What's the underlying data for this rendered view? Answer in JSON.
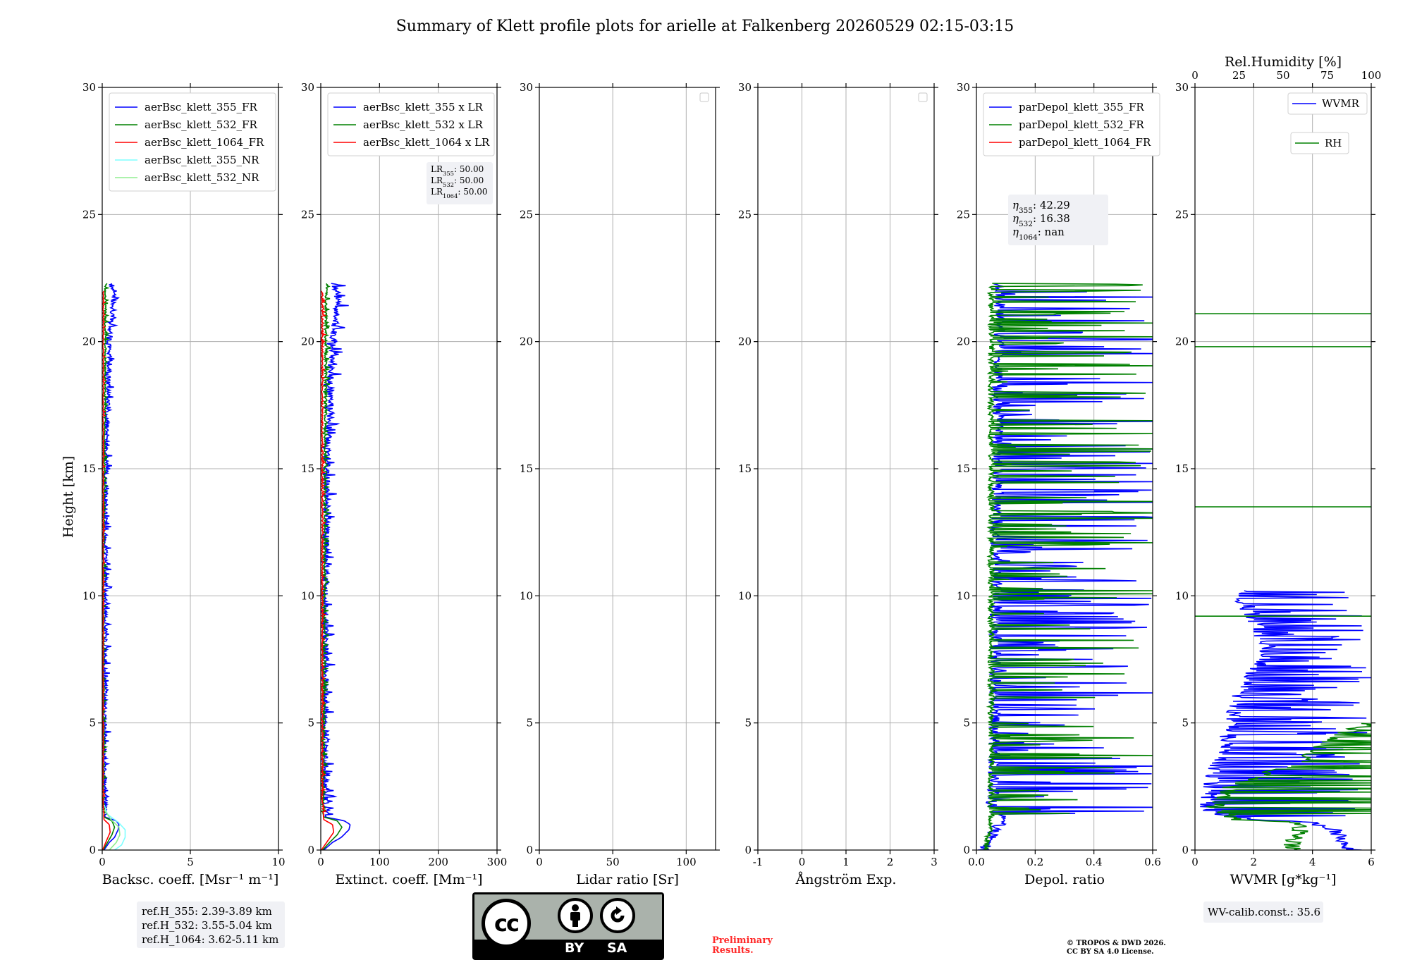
{
  "title": "Summary of Klett profile plots for arielle at Falkenberg 20260529 02:15-03:15",
  "ylabel": "Height [km]",
  "colors": {
    "blue": "#0000ff",
    "green": "#008000",
    "red": "#ff0000",
    "cyan": "#7fffff",
    "lightgreen": "#90ee90"
  },
  "chart_data": [
    {
      "type": "line",
      "id": "backscatter",
      "xlabel": "Backsc. coeff. [Msr⁻¹ m⁻¹]",
      "xlim": [
        0,
        10
      ],
      "ylim": [
        0,
        30
      ],
      "xticks": [
        0,
        5,
        10
      ],
      "yticks": [
        0,
        5,
        10,
        15,
        20,
        25,
        30
      ],
      "series": [
        {
          "name": "aerBsc_klett_355_FR",
          "color": "#0000ff",
          "style": "noisy",
          "profile": [
            [
              0,
              0.1
            ],
            [
              0.3,
              0.4
            ],
            [
              0.5,
              0.7
            ],
            [
              0.8,
              0.9
            ],
            [
              1.0,
              0.95
            ],
            [
              1.15,
              0.8
            ],
            [
              1.3,
              0.15
            ],
            [
              2,
              0.1
            ],
            [
              5,
              0.08
            ],
            [
              10,
              0.12
            ],
            [
              15,
              0.15
            ],
            [
              20,
              0.35
            ],
            [
              21.8,
              0.6
            ],
            [
              22.3,
              0.4
            ]
          ],
          "noise": 0.25
        },
        {
          "name": "aerBsc_klett_532_FR",
          "color": "#008000",
          "style": "noisy",
          "profile": [
            [
              0,
              0.05
            ],
            [
              0.3,
              0.3
            ],
            [
              0.6,
              0.55
            ],
            [
              0.9,
              0.7
            ],
            [
              1.15,
              0.55
            ],
            [
              1.3,
              0.1
            ],
            [
              2,
              0.05
            ],
            [
              10,
              0.05
            ],
            [
              20,
              0.15
            ],
            [
              22.3,
              0.15
            ]
          ],
          "noise": 0.1
        },
        {
          "name": "aerBsc_klett_1064_FR",
          "color": "#ff0000",
          "style": "noisy",
          "profile": [
            [
              0,
              0.02
            ],
            [
              0.3,
              0.2
            ],
            [
              0.7,
              0.45
            ],
            [
              1.0,
              0.4
            ],
            [
              1.2,
              0.1
            ],
            [
              2,
              0.03
            ],
            [
              21,
              0.05
            ],
            [
              22.0,
              0.05
            ]
          ],
          "noise": 0.06
        },
        {
          "name": "aerBsc_klett_355_NR",
          "color": "#7fffff",
          "style": "smooth",
          "profile": [
            [
              0,
              0.7
            ],
            [
              0.2,
              1.1
            ],
            [
              0.5,
              1.3
            ],
            [
              0.8,
              1.3
            ],
            [
              1.1,
              0.9
            ],
            [
              1.4,
              0.3
            ],
            [
              1.8,
              0.1
            ]
          ],
          "noise": 0.0
        },
        {
          "name": "aerBsc_klett_532_NR",
          "color": "#90ee90",
          "style": "smooth",
          "profile": [
            [
              0,
              0.4
            ],
            [
              0.3,
              0.8
            ],
            [
              0.6,
              1.0
            ],
            [
              0.9,
              0.95
            ],
            [
              1.2,
              0.5
            ],
            [
              1.6,
              0.1
            ]
          ],
          "noise": 0.0
        }
      ],
      "legend": {
        "placement": "top-left",
        "entries": [
          "aerBsc_klett_355_FR",
          "aerBsc_klett_532_FR",
          "aerBsc_klett_1064_FR",
          "aerBsc_klett_355_NR",
          "aerBsc_klett_532_NR"
        ]
      }
    },
    {
      "type": "line",
      "id": "extinction",
      "xlabel": "Extinct. coeff. [Mm⁻¹]",
      "xlim": [
        0,
        300
      ],
      "ylim": [
        0,
        30
      ],
      "xticks": [
        0,
        100,
        200,
        300
      ],
      "yticks": [
        0,
        5,
        10,
        15,
        20,
        25,
        30
      ],
      "series": [
        {
          "name": "aerBsc_klett_355 x LR",
          "color": "#0000ff",
          "style": "noisy",
          "profile": [
            [
              0,
              5
            ],
            [
              0.3,
              20
            ],
            [
              0.5,
              35
            ],
            [
              0.8,
              48
            ],
            [
              1.0,
              50
            ],
            [
              1.15,
              40
            ],
            [
              1.3,
              8
            ],
            [
              2,
              5
            ],
            [
              10,
              5
            ],
            [
              15,
              8
            ],
            [
              20,
              17
            ],
            [
              21.8,
              30
            ],
            [
              22.3,
              20
            ]
          ],
          "noise": 12
        },
        {
          "name": "aerBsc_klett_532 x LR",
          "color": "#008000",
          "style": "noisy",
          "profile": [
            [
              0,
              3
            ],
            [
              0.3,
              15
            ],
            [
              0.6,
              28
            ],
            [
              0.9,
              36
            ],
            [
              1.15,
              28
            ],
            [
              1.3,
              5
            ],
            [
              2,
              3
            ],
            [
              20,
              8
            ],
            [
              22.3,
              8
            ]
          ],
          "noise": 5
        },
        {
          "name": "aerBsc_klett_1064 x LR",
          "color": "#ff0000",
          "style": "noisy",
          "profile": [
            [
              0,
              1
            ],
            [
              0.3,
              10
            ],
            [
              0.7,
              22
            ],
            [
              1.0,
              20
            ],
            [
              1.2,
              5
            ],
            [
              2,
              2
            ],
            [
              22.0,
              2
            ]
          ],
          "noise": 3
        }
      ],
      "legend": {
        "placement": "top-left",
        "entries": [
          "aerBsc_klett_355 x LR",
          "aerBsc_klett_532 x LR",
          "aerBsc_klett_1064 x LR"
        ]
      },
      "annotation": {
        "lines": [
          [
            "LR",
            "355",
            ": 50.00"
          ],
          [
            "LR",
            "532",
            ": 50.00"
          ],
          [
            "LR",
            "1064",
            ": 50.00"
          ]
        ]
      }
    },
    {
      "type": "line",
      "id": "lidar-ratio",
      "xlabel": "Lidar ratio [Sr]",
      "xlim": [
        0,
        120
      ],
      "ylim": [
        0,
        30
      ],
      "xticks": [
        0,
        50,
        100
      ],
      "yticks": [
        0,
        5,
        10,
        15,
        20,
        25,
        30
      ],
      "series": [],
      "legend": {
        "placement": "top-right",
        "entries": []
      }
    },
    {
      "type": "line",
      "id": "angstrom",
      "xlabel": "Ångström Exp.",
      "xlim": [
        -1,
        3
      ],
      "ylim": [
        0,
        30
      ],
      "xticks": [
        -1,
        0,
        1,
        2,
        3
      ],
      "yticks": [
        0,
        5,
        10,
        15,
        20,
        25,
        30
      ],
      "series": [],
      "legend": {
        "placement": "top-right",
        "entries": []
      }
    },
    {
      "type": "line",
      "id": "depol",
      "xlabel": "Depol. ratio",
      "xlim": [
        0,
        0.6
      ],
      "ylim": [
        0,
        30
      ],
      "xticks": [
        0.0,
        0.2,
        0.4,
        0.6
      ],
      "yticks": [
        0,
        5,
        10,
        15,
        20,
        25,
        30
      ],
      "series": [
        {
          "name": "parDepol_klett_355_FR",
          "color": "#0000ff",
          "style": "spiky",
          "profile": [
            [
              0,
              0.02
            ],
            [
              0.3,
              0.05
            ],
            [
              0.8,
              0.06
            ],
            [
              1.2,
              0.1
            ],
            [
              1.6,
              0.05
            ],
            [
              2.5,
              0.06
            ],
            [
              22.3,
              0.08
            ]
          ],
          "noise": 0.04,
          "spike_prob": 0.22
        },
        {
          "name": "parDepol_klett_532_FR",
          "color": "#008000",
          "style": "spiky",
          "profile": [
            [
              0,
              0.03
            ],
            [
              0.5,
              0.04
            ],
            [
              1.0,
              0.05
            ],
            [
              2.0,
              0.05
            ],
            [
              22.3,
              0.05
            ]
          ],
          "noise": 0.02,
          "spike_prob": 0.16
        },
        {
          "name": "parDepol_klett_1064_FR",
          "color": "#ff0000",
          "style": "none",
          "profile": [],
          "noise": 0
        }
      ],
      "legend": {
        "placement": "top-left",
        "entries": [
          "parDepol_klett_355_FR",
          "parDepol_klett_532_FR",
          "parDepol_klett_1064_FR"
        ]
      },
      "annotation": {
        "lines": [
          [
            "η",
            "355",
            ": 42.29"
          ],
          [
            "η",
            "532",
            ": 16.38"
          ],
          [
            "η",
            "1064",
            ": nan"
          ]
        ]
      }
    },
    {
      "type": "line",
      "id": "wvmr",
      "xlabel": "WVMR [g*kg⁻¹]",
      "xlim": [
        0,
        6
      ],
      "ylim": [
        0,
        30
      ],
      "xticks": [
        0,
        2,
        4,
        6
      ],
      "yticks": [
        0,
        5,
        10,
        15,
        20,
        25,
        30
      ],
      "top_axis": {
        "label": "Rel.Humidity [%]",
        "lim": [
          0,
          100
        ],
        "ticks": [
          0,
          25,
          50,
          75,
          100
        ]
      },
      "series": [
        {
          "name": "WVMR",
          "color": "#0000ff",
          "style": "wvmr",
          "profile": [
            [
              0,
              5.4
            ],
            [
              0.1,
              5.2
            ],
            [
              0.4,
              5.0
            ],
            [
              0.8,
              4.8
            ],
            [
              1.1,
              4.0
            ],
            [
              1.2,
              2.0
            ],
            [
              1.5,
              0.5
            ],
            [
              2.0,
              0.4
            ],
            [
              2.8,
              0.6
            ],
            [
              4.0,
              1.0
            ],
            [
              6.0,
              1.5
            ],
            [
              8.0,
              2.5
            ],
            [
              10.2,
              1.5
            ]
          ],
          "noise": 0.6,
          "spike_prob": 0.35
        },
        {
          "name": "RH",
          "color": "#008000",
          "style": "rh",
          "profile": [
            [
              0,
              55
            ],
            [
              0.3,
              55
            ],
            [
              0.8,
              60
            ],
            [
              1.1,
              58
            ],
            [
              1.2,
              25
            ],
            [
              1.6,
              10
            ],
            [
              2.5,
              20
            ],
            [
              3.5,
              60
            ],
            [
              4.5,
              80
            ],
            [
              5.0,
              100
            ]
          ],
          "noise": 10,
          "spike_prob": 0.3,
          "hlines": [
            9.2,
            13.5,
            19.8,
            21.1
          ]
        }
      ],
      "legend": {
        "placement": "top-right",
        "entries": [
          "WVMR",
          "RH"
        ]
      },
      "annotation": {
        "lines": [
          [
            "WV-calib.const.: 35.6",
            "",
            ""
          ]
        ]
      }
    }
  ],
  "refh": {
    "lines": [
      "ref.H_355: 2.39-3.89 km",
      "ref.H_532: 3.55-5.04 km",
      "ref.H_1064: 3.62-5.11 km"
    ]
  },
  "license": {
    "cc": "cc",
    "by": "BY",
    "sa": "SA"
  },
  "prelim": [
    "Preliminary",
    "Results."
  ],
  "copyright": [
    "© TROPOS & DWD 2026.",
    "CC BY SA 4.0 License."
  ]
}
